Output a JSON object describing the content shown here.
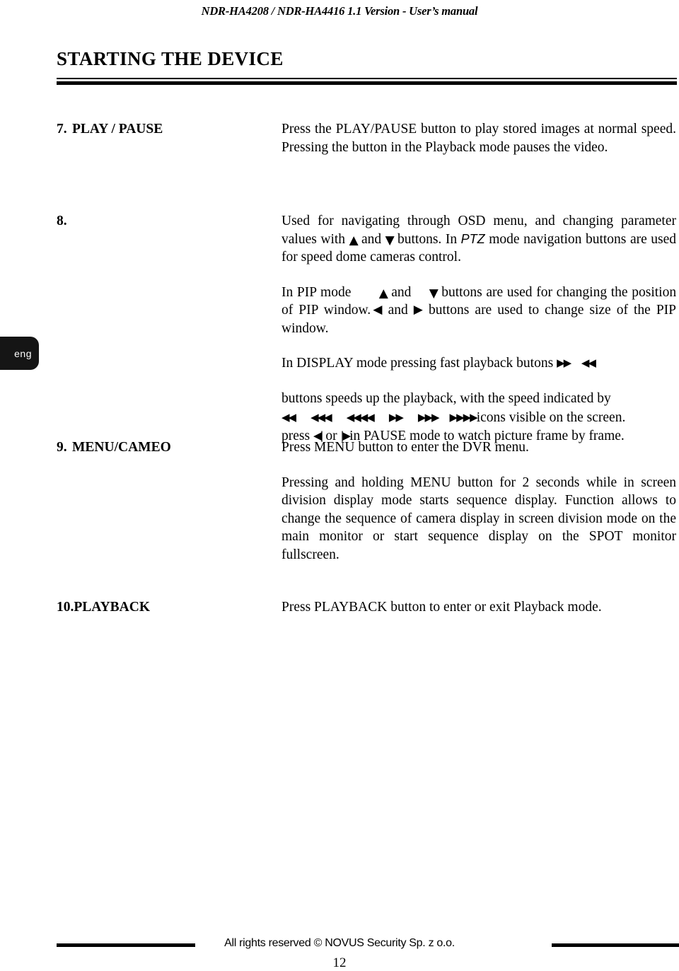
{
  "header": {
    "running_title": "NDR-HA4208 / NDR-HA4416 1.1 Version - User’s manual"
  },
  "chapter": {
    "title": "STARTING THE DEVICE"
  },
  "language_tab": {
    "label": "eng",
    "background_color": "#151515",
    "text_color": "#ffffff"
  },
  "entries": [
    {
      "number": "7.",
      "name": "PLAY / PAUSE",
      "paragraphs": [
        "Press the PLAY/PAUSE button to play stored images at normal speed. Pressing the button in the Playback mode pauses the video."
      ]
    },
    {
      "number": "8.",
      "name": "",
      "paragraphs": [
        "Used for navigating through OSD menu, and changing parameter values with ▲ and ▼ buttons. In PTZ mode navigation buttons are used for  speed dome cameras control.",
        "In PIP mode ▲ and ▼ buttons are used for changing the position of PIP window. ◀ and ▶ buttons  are used to change size of the PIP window.",
        "In DISPLAY mode pressing  fast playback butons ▶▶ ◀◀",
        "buttons speeds up the playback, with the speed indicated by ◀◀ ◀◀◀ ◀◀◀◀ ▶▶ ▶▶▶ ▶▶▶▶ icons visible on the screen. press ◀| or |▶ in  PAUSE  mode  to watch picture frame by frame."
      ]
    },
    {
      "number": "9.",
      "name": "MENU/CAMEO",
      "paragraphs": [
        "Press MENU button to enter the DVR menu.",
        "Pressing and holding MENU button for 2 seconds while in screen division display mode starts sequence display. Function allows to change the sequence of camera display in screen division mode on the main  monitor or start sequence display on the SPOT monitor fullscreen."
      ]
    },
    {
      "number": "10.",
      "name": "PLAYBACK",
      "paragraphs": [
        "Press PLAYBACK button to enter or exit Playback mode."
      ]
    }
  ],
  "entry8": {
    "p1_part1": "Used for navigating through OSD menu, and changing parameter values with",
    "p1_and": "and",
    "p1_part2": "buttons. In",
    "p1_ptz": "PTZ",
    "p1_part3": "mode navigation buttons are used for  speed dome cameras control.",
    "p2_part1": "In PIP mode",
    "p2_and1": "and",
    "p2_part2": "buttons are used for changing the position of PIP window.",
    "p2_and2": "and",
    "p2_part3": "buttons  are used to change size of the PIP window.",
    "p3_part1": "In DISPLAY mode pressing  fast playback butons",
    "p4_part1": "buttons speeds up the playback, with the speed indicated by",
    "p4_part2": "icons visible on the screen.",
    "p4_press": "press",
    "p4_or": "or",
    "p4_part3": "in  PAUSE  mode  to watch picture frame by frame.",
    "icons": {
      "rev2": "◀◀",
      "rev3": "◀◀◀",
      "rev4": "◀◀◀◀",
      "fwd2": "▶▶",
      "fwd3": "▶▶▶",
      "fwd4": "▶▶▶▶",
      "up": "▲",
      "down": "▼",
      "left": "◀",
      "right": "▶",
      "step_back": "◀|",
      "step_fwd": "|▶"
    }
  },
  "footer": {
    "copyright": "All rights reserved © NOVUS Security Sp. z o.o.",
    "page_number": "12"
  }
}
